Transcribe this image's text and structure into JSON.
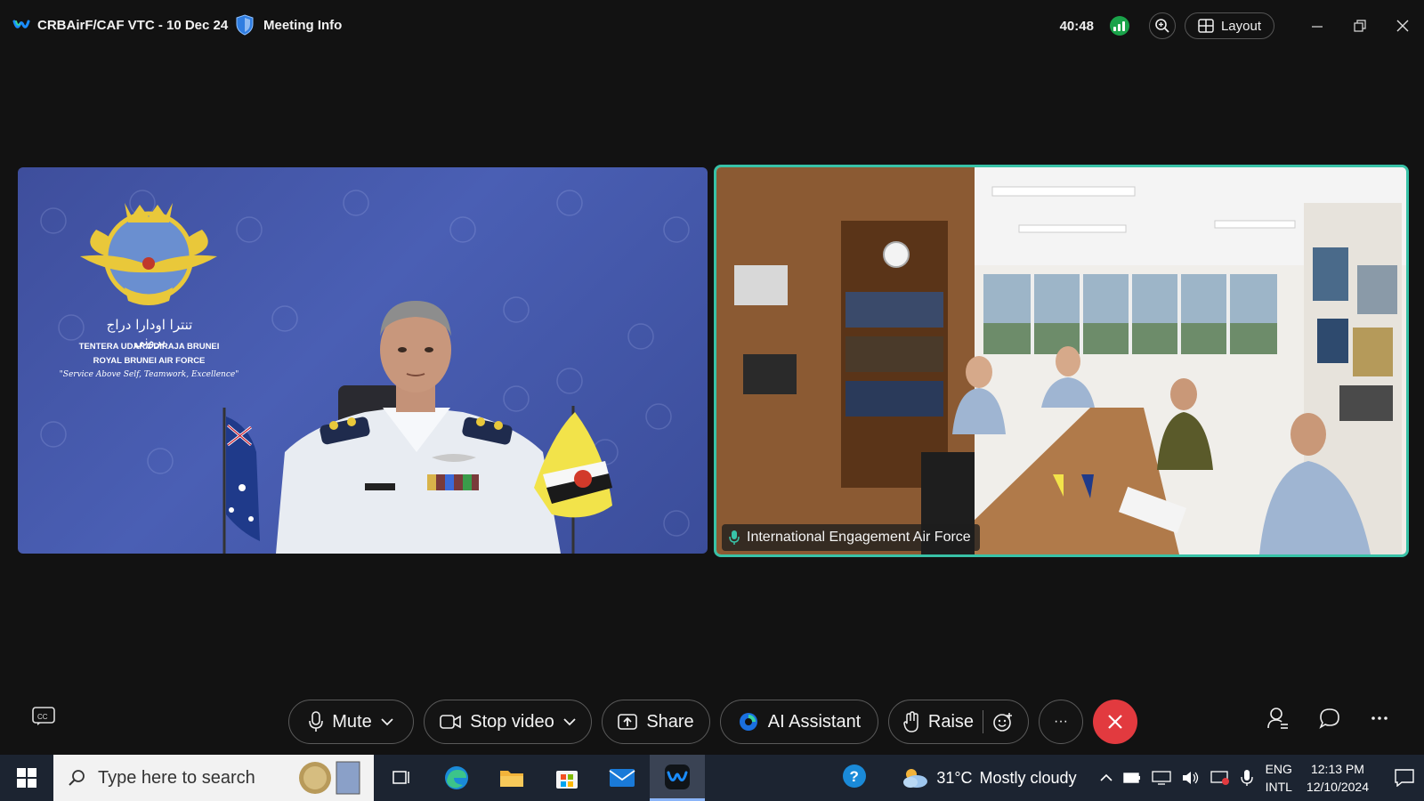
{
  "window": {
    "title": "CRBAirF/CAF VTC - 10 Dec 24",
    "meeting_info_label": "Meeting Info",
    "timer": "40:48",
    "layout_label": "Layout"
  },
  "tiles": {
    "left": {
      "crest_text_arabic": "تنترا اودارا دراج بروني",
      "crest_line1": "TENTERA UDARA DIRAJA BRUNEI",
      "crest_line2": "ROYAL BRUNEI AIR FORCE",
      "crest_motto": "\"Service Above Self, Teamwork, Excellence\""
    },
    "right": {
      "name": "International Engagement Air Force"
    }
  },
  "controls": {
    "mute_label": "Mute",
    "video_label": "Stop video",
    "share_label": "Share",
    "ai_label": "AI Assistant",
    "raise_label": "Raise",
    "more_label": "···"
  },
  "taskbar": {
    "search_placeholder": "Type here to search",
    "weather_temp": "31°C",
    "weather_desc": "Mostly cloudy",
    "lang_top": "ENG",
    "lang_bottom": "INTL",
    "time": "12:13 PM",
    "date": "12/10/2024"
  },
  "colors": {
    "accent_active_speaker": "#38c2a7",
    "end_call": "#e23a3f",
    "signal": "#1aa34a",
    "taskbar": "#1c2431"
  }
}
